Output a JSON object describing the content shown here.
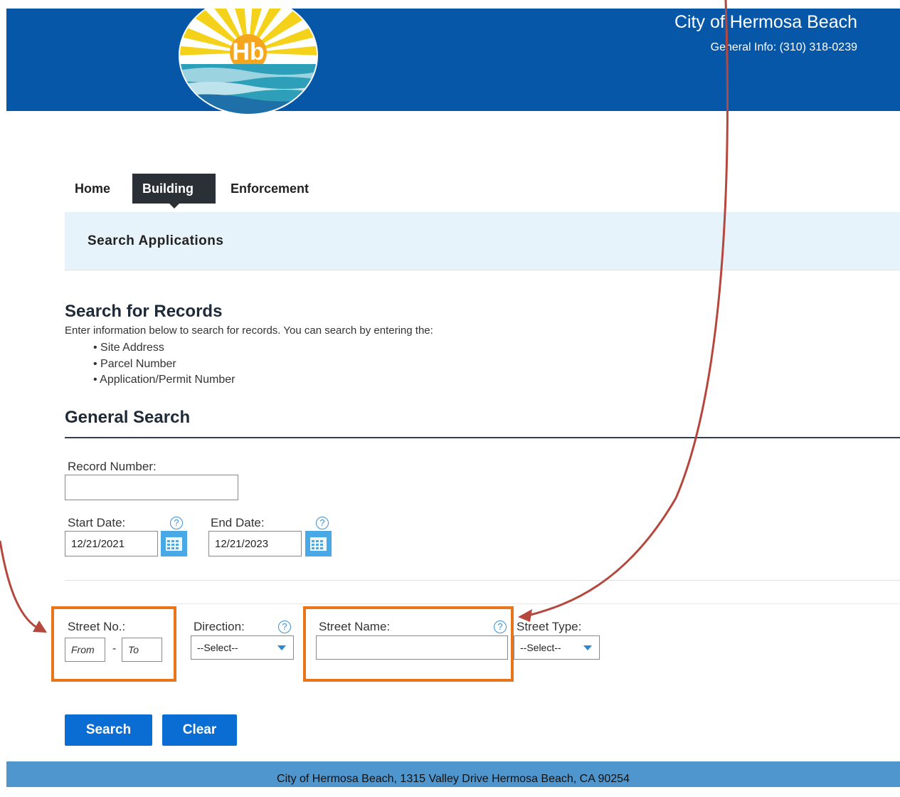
{
  "header": {
    "title": "City of Hermosa Beach",
    "general_info": "General Info: (310) 318-0239",
    "logo_text": "Hb"
  },
  "nav": {
    "tabs": [
      {
        "label": "Home",
        "active": false
      },
      {
        "label": "Building",
        "active": true
      },
      {
        "label": "Enforcement",
        "active": false
      }
    ]
  },
  "subnav": {
    "title": "Search Applications"
  },
  "search_records": {
    "title": "Search for Records",
    "description": "Enter information below to search for records. You can search by entering the:",
    "bullets": [
      "• Site Address",
      "• Parcel Number",
      "• Application/Permit Number"
    ]
  },
  "general_search": {
    "title": "General Search",
    "record_number_label": "Record Number:",
    "record_number_value": "",
    "start_date_label": "Start Date:",
    "start_date_value": "12/21/2021",
    "end_date_label": "End Date:",
    "end_date_value": "12/21/2023",
    "street_no_label": "Street No.:",
    "street_no_from_placeholder": "From",
    "street_no_to_placeholder": "To",
    "street_no_separator": "-",
    "direction_label": "Direction:",
    "direction_value": "--Select--",
    "street_name_label": "Street Name:",
    "street_name_value": "",
    "street_type_label": "Street Type:",
    "street_type_value": "--Select--",
    "help_glyph": "?"
  },
  "buttons": {
    "search": "Search",
    "clear": "Clear"
  },
  "footer": {
    "text": "City of Hermosa Beach, 1315 Valley Drive Hermosa Beach, CA 90254"
  },
  "colors": {
    "header_bg": "#0757a8",
    "nav_active_bg": "#2b2f36",
    "subnav_bg": "#e6f3fa",
    "button_bg": "#0a6dd4",
    "footer_bg": "#4f95ce",
    "highlight_orange": "#e8751a",
    "annotation_arrow": "#b5473d",
    "calendar_icon": "#48a9e6"
  },
  "icons": [
    "hermosa-beach-logo",
    "help-icon",
    "calendar-icon",
    "chevron-down-icon"
  ]
}
